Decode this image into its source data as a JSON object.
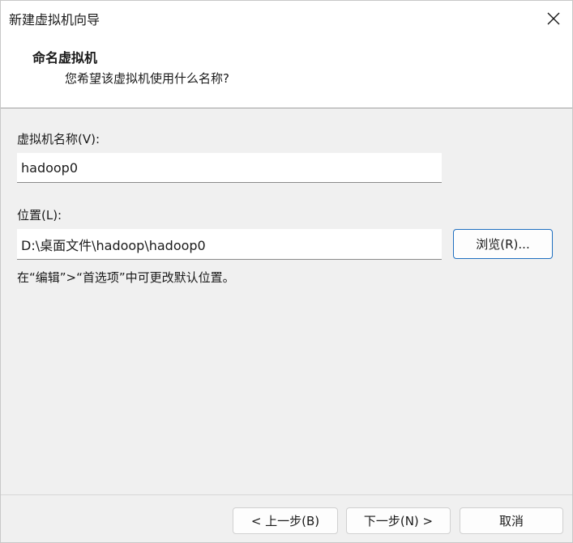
{
  "window": {
    "title": "新建虚拟机向导"
  },
  "header": {
    "title": "命名虚拟机",
    "subtitle": "您希望该虚拟机使用什么名称?"
  },
  "form": {
    "name_label": "虚拟机名称(V):",
    "name_value": "hadoop0",
    "location_label": "位置(L):",
    "location_value": "D:\\桌面文件\\hadoop\\hadoop0",
    "browse_label": "浏览(R)...",
    "hint": "在“编辑”>“首选项”中可更改默认位置。"
  },
  "footer": {
    "back_label": "< 上一步(B)",
    "next_label": "下一步(N) >",
    "cancel_label": "取消"
  },
  "icons": {
    "close": "close-icon"
  },
  "colors": {
    "focus_border": "#1f6fc0",
    "background": "#f0f0f0",
    "header_bg": "#ffffff"
  }
}
